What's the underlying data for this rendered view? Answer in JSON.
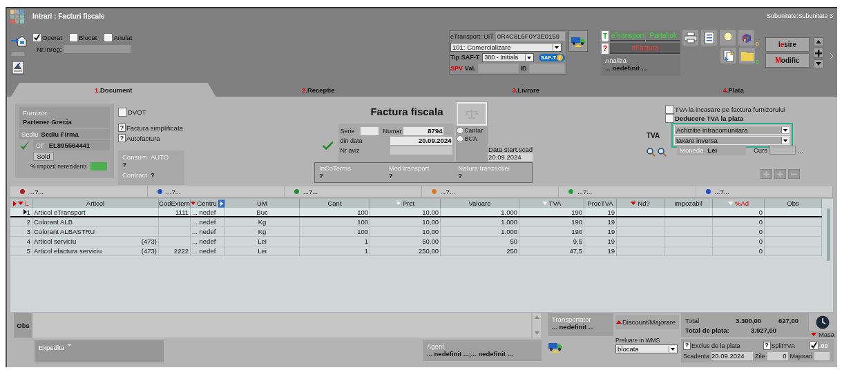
{
  "window": {
    "title": "Intrari : Facturi fiscale",
    "subunit": "Subunitate:Subunitate 3"
  },
  "flags": [
    {
      "label": "Operat",
      "checked": true
    },
    {
      "label": "Blocat",
      "checked": false
    },
    {
      "label": "Anulat",
      "checked": false
    }
  ],
  "nr_inreg_label": "Nr.Inreg:",
  "etransport": {
    "uit_label": "eTransport: UIT",
    "uit": "0R4C8L6F0Y3E0159",
    "operation": "101: Comercializare",
    "saft_label": "Tip SAF-T",
    "saft_type": "380 - Initiala",
    "saft_badge": "SAF-T",
    "spv": "SPV",
    "val_label": "Val.",
    "id_label": "ID"
  },
  "status_panel": {
    "t_mark": "T",
    "etransport": "eTransport",
    "partial": "Partal:ok",
    "q_mark": "?",
    "efactura": "eFactura",
    "analiza_label": "Analiza",
    "analiza": "... nedefinit ..."
  },
  "counters": [
    "0",
    "0"
  ],
  "actions": [
    {
      "parts": [
        {
          "text": "I",
          "hot": false
        },
        {
          "text": "e",
          "hot": true
        },
        {
          "text": "sire",
          "hot": false
        }
      ]
    },
    {
      "parts": [
        {
          "text": "M",
          "hot": true
        },
        {
          "text": "odific",
          "hot": false
        }
      ]
    }
  ],
  "tabs": [
    {
      "number": "1",
      "label": ".Document",
      "selected": true
    },
    {
      "number": "2",
      "label": ".Receptie",
      "selected": false
    },
    {
      "number": "3",
      "label": ".Livrare",
      "selected": false
    },
    {
      "number": "4",
      "label": ".Plata",
      "selected": false
    }
  ],
  "document": {
    "supplier_label": "Furnizor",
    "supplier": "Partener Grecia",
    "seat_label": "Sediu",
    "seat": "Sediu Firma",
    "verified": true,
    "cf_label": "CF",
    "cf": "EL895564441",
    "sold": "Sold",
    "tax_label": "% impozit nerezidenti",
    "dvot": {
      "label": "DVOT",
      "checked": false
    },
    "options": [
      {
        "box": "?",
        "label": "Factura simplificata",
        "indeterminate": true
      },
      {
        "box": "?",
        "label": "Autofactura",
        "indeterminate": true
      }
    ],
    "consum_label": "Consum",
    "consum": "AUTO",
    "consum_value": "?",
    "contract_label": "Contract",
    "contract": "?",
    "heading": "Factura fiscala",
    "serie_label": "Serie",
    "numar_label": "Numar",
    "numar": "8794",
    "date_label": "din data",
    "date": "20.09.2024",
    "aviz_label": "Nr aviz",
    "valid": true,
    "weigh": [
      {
        "label": "Cantar",
        "selected": false
      },
      {
        "label": "BCA",
        "selected": false
      }
    ],
    "due_label": "Data start.scad",
    "due": "20.09.2024",
    "trade": [
      {
        "label": "InCoTerms",
        "value": "?"
      },
      {
        "label": "Mod transport",
        "value": "?"
      },
      {
        "label": "Natura tranzactiei",
        "value": "?"
      }
    ]
  },
  "vat": {
    "on_receipt": {
      "label": "TVA la incasare pe factura furnizorului",
      "checked": false
    },
    "deduction": {
      "label": "Deducere TVA la plata",
      "checked": false
    },
    "label": "TVA",
    "regime": "Achizitie intracomunitara",
    "mode": "taxare inversa",
    "currency_label": "Moneda",
    "currency": "Lei",
    "rate_label": "Curs",
    "more": "..."
  },
  "groups": [
    {
      "label": "...?...",
      "color": "#b02020"
    },
    {
      "label": "...?...",
      "color": "#2050c0"
    },
    {
      "label": "...?...",
      "color": "#209030"
    },
    {
      "label": "...?...",
      "color": "#e07818"
    },
    {
      "label": "...?...",
      "color": "#20a040"
    },
    {
      "label": "...?...",
      "color": "#2048d0"
    }
  ],
  "table": {
    "columns": [
      {
        "label": "L",
        "filtered": true,
        "highlight": true
      },
      {
        "label": "Articol",
        "highlight": false
      },
      {
        "label": "CodExtern",
        "highlight": false
      },
      {
        "label": "Centru",
        "filtered": true,
        "highlight": false
      },
      {
        "label": "UM",
        "highlight": false
      },
      {
        "label": "Cant",
        "highlight": false
      },
      {
        "label": "Pret",
        "sorted": true,
        "highlight": false
      },
      {
        "label": "Valoare",
        "highlight": false
      },
      {
        "label": "TVA",
        "sorted": true,
        "highlight": false
      },
      {
        "label": "ProcTVA",
        "highlight": false
      },
      {
        "label": "Nd?",
        "filtered": true,
        "highlight": false
      },
      {
        "label": "Impozabil",
        "highlight": false
      },
      {
        "label": "%Ad",
        "sorted": true,
        "highlight": true
      },
      {
        "label": "Obs",
        "highlight": false
      }
    ],
    "rows": [
      {
        "nr": "1",
        "articol": "Articol eTransport",
        "code": "1111",
        "centru": "... nedef",
        "um": "Buc",
        "cant": "100",
        "pret": "10,00",
        "valoare": "1.000",
        "tva": "190",
        "proc_tva": "19",
        "ad": "0",
        "selected": true
      },
      {
        "nr": "2",
        "articol": "Colorant ALB",
        "centru": "... nedef",
        "um": "Kg",
        "cant": "100",
        "pret": "10,00",
        "valoare": "1.000",
        "tva": "190",
        "proc_tva": "19",
        "ad": "0",
        "selected": false
      },
      {
        "nr": "3",
        "articol": "Colorant ALBASTRU",
        "centru": "... nedef",
        "um": "Kg",
        "cant": "100",
        "pret": "10,00",
        "valoare": "1.000",
        "tva": "190",
        "proc_tva": "19",
        "ad": "0",
        "selected": false
      },
      {
        "nr": "4",
        "articol": "Articol serviciu",
        "account": "(473)",
        "centru": "... nedef",
        "um": "Lei",
        "cant": "1",
        "pret": "50,00",
        "valoare": "50",
        "tva": "9,5",
        "proc_tva": "19",
        "ad": "0",
        "selected": false
      },
      {
        "nr": "5",
        "articol": "Articol efactura serviciu",
        "account": "(473)",
        "code": "2222",
        "centru": "... nedef",
        "um": "Lei",
        "cant": "1",
        "pret": "250,00",
        "valoare": "250",
        "tva": "47,5",
        "proc_tva": "19",
        "ad": "0",
        "selected": false
      }
    ]
  },
  "footer": {
    "obs_label": "Obs",
    "expedita": "Expedita",
    "transporter_label": "Transportator",
    "transporter": "... nedefinit ...",
    "agent_label": "Agent",
    "agent": "... nedefinit ...;... nedefinit ...",
    "discount": "Discount/Majorare",
    "wms_label": "Preluare in WMS",
    "wms": "blocata",
    "total_label": "Total",
    "net": "3.300,00",
    "vat": "627,00",
    "pay_label": "Total de plata:",
    "pay": "3.927,00",
    "masa": "Masa",
    "excluded": {
      "box": "?",
      "label": "Exclus de la plata",
      "indeterminate": true
    },
    "split": {
      "box": "?",
      "label": "SplitTVA",
      "indeterminate": true
    },
    "rounding": {
      "label": ".00",
      "checked": true
    },
    "due_label": "Scadenta",
    "due": "20.09.2024",
    "days_label": "Zile",
    "days": "0",
    "penalty_label": "Majorari"
  }
}
